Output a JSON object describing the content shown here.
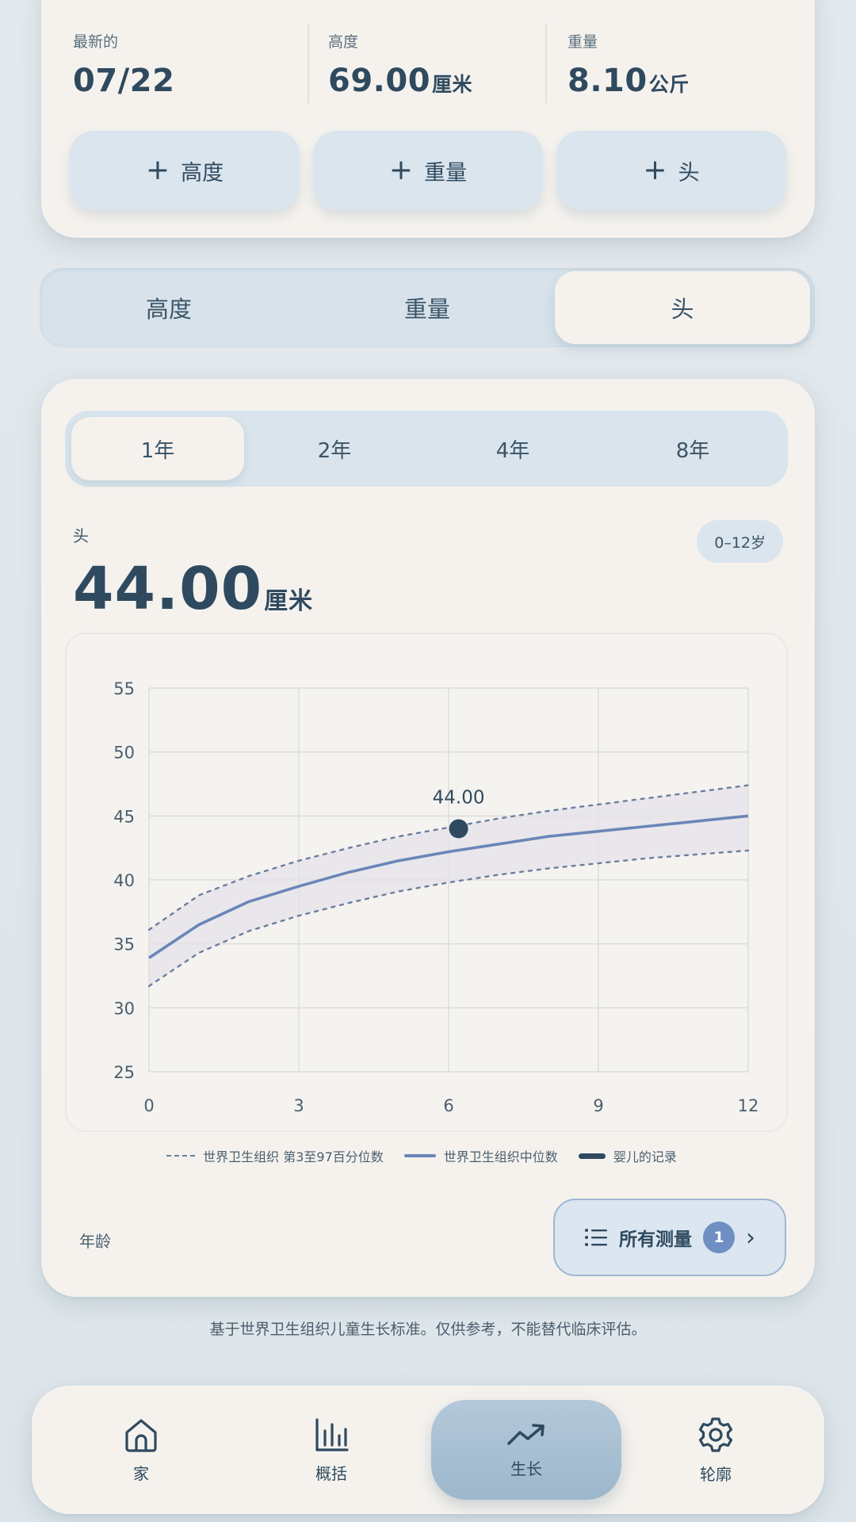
{
  "summary": {
    "latest_label": "最新的",
    "latest_value": "07/22",
    "height_label": "高度",
    "height_value": "69.00",
    "height_unit": "厘米",
    "weight_label": "重量",
    "weight_value": "8.10",
    "weight_unit": "公斤",
    "add_buttons": [
      {
        "icon": "plus-icon",
        "label": "高度"
      },
      {
        "icon": "plus-icon",
        "label": "重量"
      },
      {
        "icon": "plus-icon",
        "label": "头"
      }
    ]
  },
  "metric_tabs": [
    {
      "label": "高度",
      "active": false
    },
    {
      "label": "重量",
      "active": false
    },
    {
      "label": "头",
      "active": true
    }
  ],
  "range_tabs": [
    {
      "label": "1年",
      "active": true
    },
    {
      "label": "2年",
      "active": false
    },
    {
      "label": "4年",
      "active": false
    },
    {
      "label": "8年",
      "active": false
    }
  ],
  "metric": {
    "label": "头",
    "value": "44.00",
    "unit": "厘米",
    "age_badge": "0–12岁"
  },
  "chart_data": {
    "type": "line",
    "xlabel": "年龄",
    "ylabel": "",
    "xlim": [
      0,
      12
    ],
    "ylim": [
      25,
      55
    ],
    "x_ticks": [
      "0",
      "3",
      "6",
      "9",
      "12"
    ],
    "y_ticks": [
      "55",
      "50",
      "45",
      "40",
      "35",
      "30",
      "25"
    ],
    "grid": true,
    "series": [
      {
        "name": "世界卫生组织 第3至97百分位数",
        "style": "dashed",
        "x": [
          0,
          1,
          2,
          3,
          4,
          5,
          6,
          7,
          8,
          9,
          10,
          11,
          12
        ],
        "values": [
          36.1,
          38.8,
          40.3,
          41.5,
          42.5,
          43.4,
          44.1,
          44.8,
          45.4,
          45.9,
          46.4,
          46.9,
          47.4
        ]
      },
      {
        "name": "",
        "style": "dashed",
        "x": [
          0,
          1,
          2,
          3,
          4,
          5,
          6,
          7,
          8,
          9,
          10,
          11,
          12
        ],
        "values": [
          31.7,
          34.3,
          36.0,
          37.2,
          38.2,
          39.1,
          39.8,
          40.4,
          40.9,
          41.3,
          41.7,
          42.0,
          42.3
        ]
      },
      {
        "name": "世界卫生组织中位数",
        "style": "solid",
        "x": [
          0,
          1,
          2,
          3,
          4,
          5,
          6,
          7,
          8,
          9,
          10,
          11,
          12
        ],
        "values": [
          33.9,
          36.5,
          38.3,
          39.5,
          40.6,
          41.5,
          42.2,
          42.8,
          43.4,
          43.8,
          44.2,
          44.6,
          45.0
        ]
      },
      {
        "name": "婴儿的记录",
        "style": "point",
        "x": [
          6.2
        ],
        "values": [
          44.0
        ],
        "labels": [
          "44.00"
        ]
      }
    ],
    "colors": {
      "band": "#e4e3ea",
      "dashed": "#6b7f9e",
      "median": "#6a86b8",
      "point": "#2f4a5f"
    }
  },
  "all_measurements": {
    "label": "所有测量",
    "count": "1",
    "icon": "list-icon",
    "chevron": "›"
  },
  "footnote": "基于世界卫生组织儿童生长标准。仅供参考，不能替代临床评估。",
  "nav": [
    {
      "label": "家",
      "icon": "home-icon",
      "active": false
    },
    {
      "label": "概括",
      "icon": "bar-chart-icon",
      "active": false
    },
    {
      "label": "生长",
      "icon": "trend-up-icon",
      "active": true
    },
    {
      "label": "轮廓",
      "icon": "gear-icon",
      "active": false
    }
  ]
}
